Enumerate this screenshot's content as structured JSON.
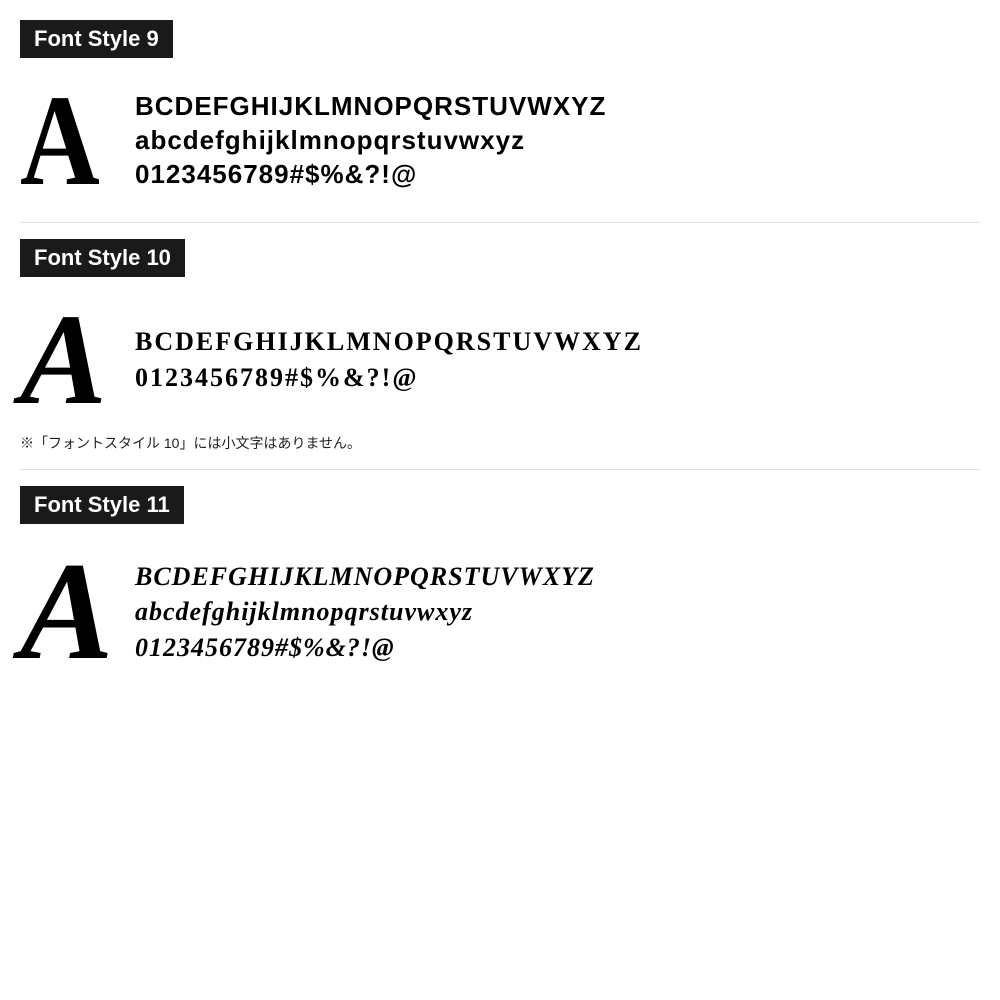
{
  "sections": [
    {
      "id": "font9",
      "label": "Font Style 9",
      "big_letter": "A",
      "lines": [
        "BCDEFGHIJKLMNOPQRSTUVWXYZ",
        "abcdefghijklmnopqrstuvwxyz",
        "0123456789#$%&?!@"
      ],
      "note": null
    },
    {
      "id": "font10",
      "label": "Font Style 10",
      "big_letter": "A",
      "lines": [
        "BCDEFGHIJKLMNOPQRSTUVWXYZ",
        "0123456789#$%&?!@"
      ],
      "note": "※「フォントスタイル 10」には小文字はありません。"
    },
    {
      "id": "font11",
      "label": "Font Style 11",
      "big_letter": "A",
      "lines": [
        "BCDEFGHIJKLMNOPQRSTUVWXYZ",
        "abcdefghijklmnopqrstuvwxyz",
        "0123456789#$%&?!@"
      ],
      "note": null
    }
  ]
}
